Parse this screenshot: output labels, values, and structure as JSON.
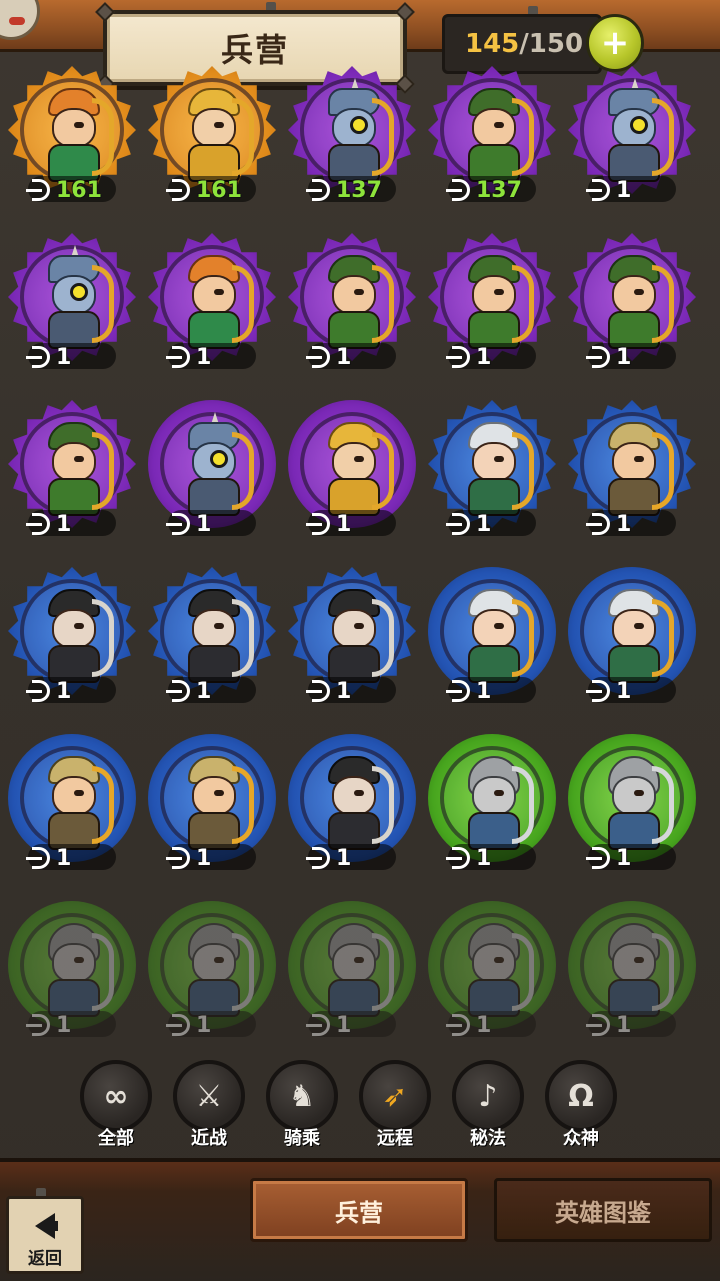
{
  "header": {
    "title": "兵营",
    "capacity_current": "145",
    "capacity_separator": "/",
    "capacity_max": "150",
    "plus_symbol": "+"
  },
  "units": [
    {
      "type": "elfgirl",
      "tier": "gold",
      "shape": "spiky",
      "count": "161",
      "count_color": "green"
    },
    {
      "type": "goldk",
      "tier": "gold",
      "shape": "spiky",
      "count": "161",
      "count_color": "green"
    },
    {
      "type": "beast",
      "tier": "purple",
      "shape": "spiky",
      "count": "137",
      "count_color": "green"
    },
    {
      "type": "ranger",
      "tier": "purple",
      "shape": "spiky",
      "count": "137",
      "count_color": "green"
    },
    {
      "type": "beast",
      "tier": "purple",
      "shape": "spiky",
      "count": "1",
      "count_color": "white"
    },
    {
      "type": "beast",
      "tier": "purple",
      "shape": "spiky",
      "count": "1",
      "count_color": "white"
    },
    {
      "type": "elfgirl",
      "tier": "purple",
      "shape": "spiky",
      "count": "1",
      "count_color": "white"
    },
    {
      "type": "ranger",
      "tier": "purple",
      "shape": "spiky",
      "count": "1",
      "count_color": "white"
    },
    {
      "type": "ranger",
      "tier": "purple",
      "shape": "spiky",
      "count": "1",
      "count_color": "white"
    },
    {
      "type": "ranger",
      "tier": "purple",
      "shape": "spiky",
      "count": "1",
      "count_color": "white"
    },
    {
      "type": "ranger",
      "tier": "purple",
      "shape": "spiky",
      "count": "1",
      "count_color": "white"
    },
    {
      "type": "beast",
      "tier": "purple",
      "shape": "round",
      "count": "1",
      "count_color": "white"
    },
    {
      "type": "goldk",
      "tier": "purple",
      "shape": "round",
      "count": "1",
      "count_color": "white"
    },
    {
      "type": "elfm",
      "tier": "blue",
      "shape": "spiky",
      "count": "1",
      "count_color": "white"
    },
    {
      "type": "goldh",
      "tier": "blue",
      "shape": "spiky",
      "count": "1",
      "count_color": "white"
    },
    {
      "type": "ninja",
      "tier": "blue",
      "shape": "spiky",
      "count": "1",
      "count_color": "white"
    },
    {
      "type": "ninja",
      "tier": "blue",
      "shape": "spiky",
      "count": "1",
      "count_color": "white"
    },
    {
      "type": "ninja",
      "tier": "blue",
      "shape": "spiky",
      "count": "1",
      "count_color": "white"
    },
    {
      "type": "elfm",
      "tier": "blue",
      "shape": "round",
      "count": "1",
      "count_color": "white"
    },
    {
      "type": "elfm",
      "tier": "blue",
      "shape": "round",
      "count": "1",
      "count_color": "white"
    },
    {
      "type": "goldh",
      "tier": "blue",
      "shape": "round",
      "count": "1",
      "count_color": "white"
    },
    {
      "type": "goldh",
      "tier": "blue",
      "shape": "round",
      "count": "1",
      "count_color": "white"
    },
    {
      "type": "ninja",
      "tier": "blue",
      "shape": "round",
      "count": "1",
      "count_color": "white"
    },
    {
      "type": "helm",
      "tier": "green",
      "shape": "round",
      "count": "1",
      "count_color": "white"
    },
    {
      "type": "helm",
      "tier": "green",
      "shape": "round",
      "count": "1",
      "count_color": "white"
    },
    {
      "type": "helm",
      "tier": "green",
      "shape": "round",
      "count": "1",
      "count_color": "white",
      "dim": true
    },
    {
      "type": "helm",
      "tier": "green",
      "shape": "round",
      "count": "1",
      "count_color": "white",
      "dim": true
    },
    {
      "type": "helm",
      "tier": "green",
      "shape": "round",
      "count": "1",
      "count_color": "white",
      "dim": true
    },
    {
      "type": "helm",
      "tier": "green",
      "shape": "round",
      "count": "1",
      "count_color": "white",
      "dim": true
    },
    {
      "type": "helm",
      "tier": "green",
      "shape": "round",
      "count": "1",
      "count_color": "white",
      "dim": true
    }
  ],
  "filters": [
    {
      "id": "all",
      "icon": "∞",
      "icon_name": "infinity-icon",
      "label": "全部",
      "active": false
    },
    {
      "id": "melee",
      "icon": "⚔",
      "icon_name": "sword-icon",
      "label": "近战",
      "active": false
    },
    {
      "id": "mounted",
      "icon": "♞",
      "icon_name": "horse-icon",
      "label": "骑乘",
      "active": false
    },
    {
      "id": "ranged",
      "icon": "➶",
      "icon_name": "bow-icon",
      "label": "远程",
      "active": true
    },
    {
      "id": "arcane",
      "icon": "♪",
      "icon_name": "arcane-icon",
      "label": "秘法",
      "active": false
    },
    {
      "id": "gods",
      "icon": "Ω",
      "icon_name": "omega-icon",
      "label": "众神",
      "active": false
    }
  ],
  "bottom": {
    "back_label": "返回",
    "tab_barracks": "兵营",
    "tab_heroes": "英雄图鉴"
  }
}
